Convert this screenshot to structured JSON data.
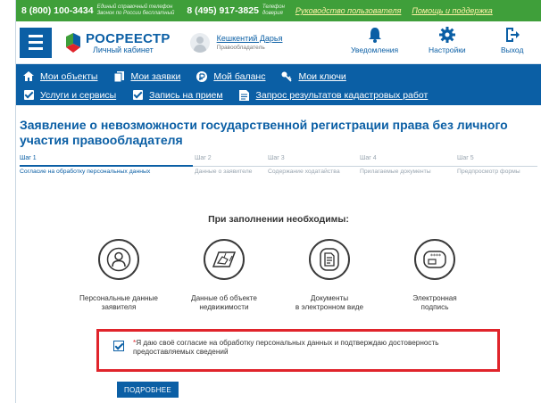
{
  "topbar": {
    "phone1": "8 (800) 100-3434",
    "phone1_note": "Единый справочный телефон\nЗвонок по России бесплатный",
    "phone2": "8 (495) 917-3825",
    "phone2_note": "Телефон\nдоверия",
    "link_guide": "Руководство пользователя",
    "link_help": "Помощь и поддержка"
  },
  "header": {
    "brand": "РОСРЕЕСТР",
    "brand_sub": "Личный кабинет",
    "user_name": "Кешкентий Дарья",
    "user_role": "Правообладатель",
    "notifications": "Уведомления",
    "settings": "Настройки",
    "logout": "Выход"
  },
  "nav": {
    "row1": [
      {
        "label": "Мои объекты",
        "icon": "home-icon"
      },
      {
        "label": "Мои заявки",
        "icon": "documents-icon"
      },
      {
        "label": "Мой баланс",
        "icon": "ruble-icon"
      },
      {
        "label": "Мои ключи",
        "icon": "key-icon"
      }
    ],
    "row2": [
      {
        "label": "Услуги и сервисы",
        "icon": "checkbox-icon"
      },
      {
        "label": "Запись на прием",
        "icon": "checkbox-icon"
      },
      {
        "label": "Запрос результатов кадастровых работ",
        "icon": "file-icon"
      }
    ]
  },
  "page": {
    "title": "Заявление о невозможности государственной регистрации права без личного участия правообладателя"
  },
  "steps": [
    {
      "num": "Шаг 1",
      "label": "Согласие на обработку персональных данных"
    },
    {
      "num": "Шаг 2",
      "label": "Данные о заявителе"
    },
    {
      "num": "Шаг 3",
      "label": "Содержание ходатайства"
    },
    {
      "num": "Шаг 4",
      "label": "Прилагаемые документы"
    },
    {
      "num": "Шаг 5",
      "label": "Предпросмотр формы"
    }
  ],
  "required": {
    "heading": "При заполнении необходимы:",
    "items": [
      {
        "label": "Персональные данные\nзаявителя",
        "icon": "person-icon"
      },
      {
        "label": "Данные об объекте\nнедвижимости",
        "icon": "property-map-icon"
      },
      {
        "label": "Документы\nв электронном виде",
        "icon": "electronic-document-icon"
      },
      {
        "label": "Электронная\nподпись",
        "icon": "digital-signature-card-icon"
      }
    ]
  },
  "consent": {
    "star": "*",
    "text": "Я даю своё согласие на обработку персональных данных и подтверждаю достоверность предоставляемых сведений",
    "checked": true
  },
  "buttons": {
    "more": "ПОДРОБНЕЕ"
  },
  "colors": {
    "topbar": "#3f9f3a",
    "primary": "#0b5fa5",
    "highlight_border": "#e0242b"
  }
}
